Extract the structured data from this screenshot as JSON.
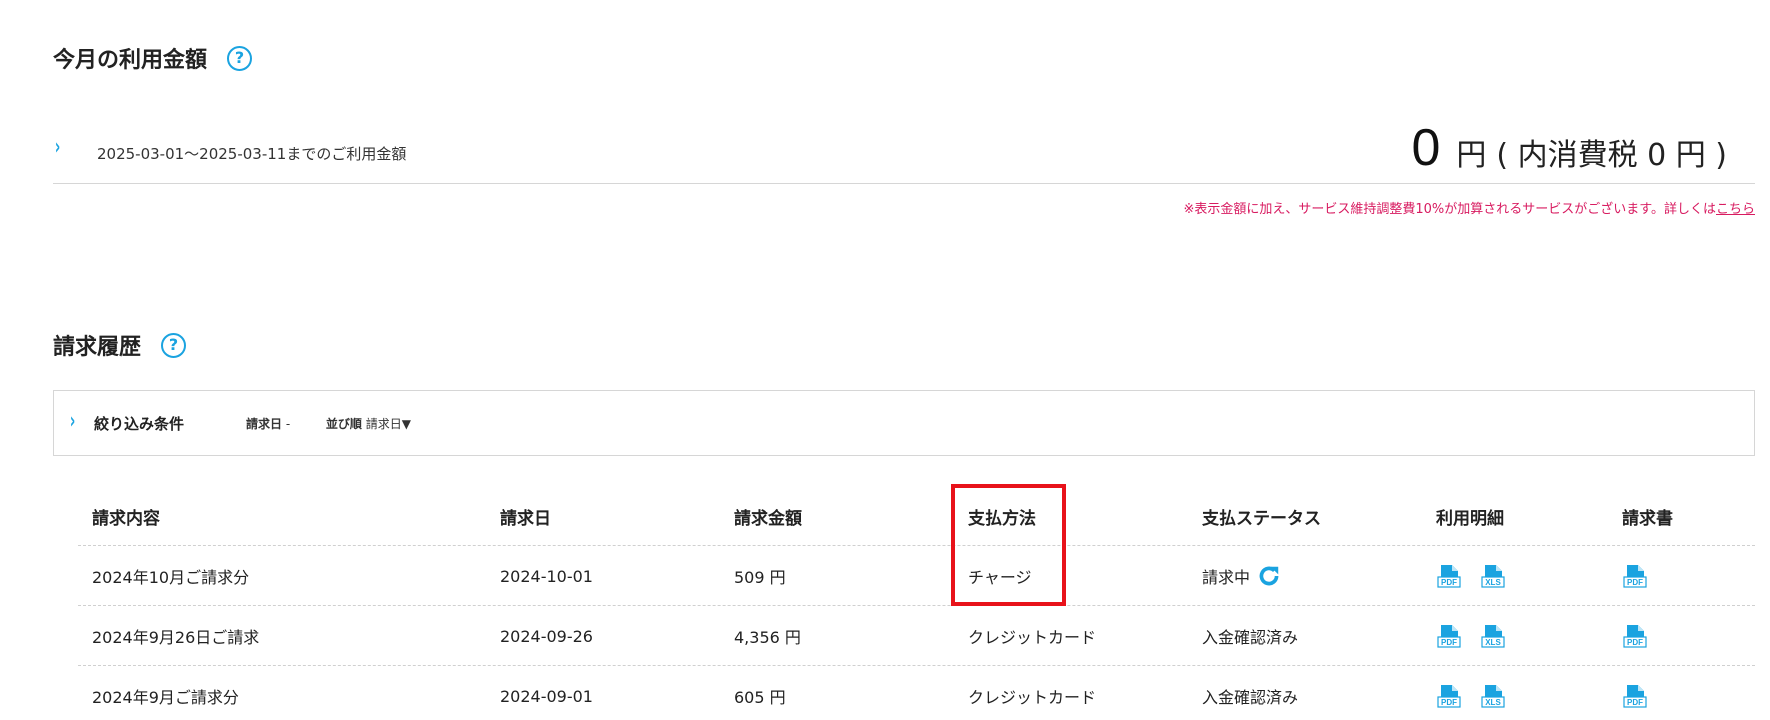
{
  "usage": {
    "title": "今月の利用金額",
    "help_icon": "?",
    "chevron": "›",
    "period": "2025-03-01～2025-03-11までのご利用金額",
    "amount": "0",
    "unit": "円",
    "tax_text": "( 内消費税 0 円 )",
    "notice": "※表示金額に加え、サービス維持調整費10%が加算されるサービスがございます。詳しくは",
    "notice_link": "こちら"
  },
  "history": {
    "title": "請求履歴",
    "help_icon": "?",
    "filter": {
      "chevron": "›",
      "label": "絞り込み条件",
      "date_label": "請求日",
      "date_value": "-",
      "sort_label": "並び順",
      "sort_value": "請求日▼"
    },
    "columns": [
      "請求内容",
      "請求日",
      "請求金額",
      "支払方法",
      "支払ステータス",
      "利用明細",
      "請求書"
    ],
    "rows": [
      {
        "content": "2024年10月ご請求分",
        "date": "2024-10-01",
        "amount": "509 円",
        "method": "チャージ",
        "status": "請求中"
      },
      {
        "content": "2024年9月26日ご請求",
        "date": "2024-09-26",
        "amount": "4,356 円",
        "method": "クレジットカード",
        "status": "入金確認済み"
      },
      {
        "content": "2024年9月ご請求分",
        "date": "2024-09-01",
        "amount": "605 円",
        "method": "クレジットカード",
        "status": "入金確認済み"
      }
    ],
    "file_labels": {
      "pdf": "PDF",
      "xls": "XLS"
    }
  },
  "colors": {
    "accent": "#1aa3e0",
    "notice": "#d81b60",
    "highlight": "#e8121a"
  }
}
